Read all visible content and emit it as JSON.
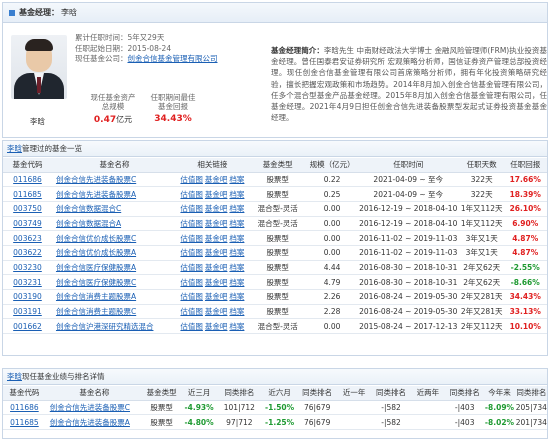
{
  "header": {
    "label": "基金经理：",
    "name": "李晗"
  },
  "profile": {
    "name": "李晗",
    "tenure_label": "累计任职时间：",
    "tenure_value": "5年又29天",
    "start_label": "任职起始日期：",
    "start_value": "2015-08-24",
    "company_label": "现任基金公司：",
    "company_value": "创金合信基金管理有限公司",
    "stat1_label_1": "现任基金资产",
    "stat1_label_2": "总规模",
    "stat1_value": "0.47",
    "stat1_unit": "亿元",
    "stat2_label_1": "任职期间最佳",
    "stat2_label_2": "基金回报",
    "stat2_value": "34.43%"
  },
  "bio": {
    "title": "基金经理简介：",
    "text": "李晗先生 中南财经政法大学博士 金融风险管理师(FRM)执业投资基金经理。曾任国泰君安证券研究所 宏观策略分析师，国信证券资产管理总部投资经理。现任创金合信基金管理有限公司首席策略分析师，拥有年化投资策略研究经验，擅长把握宏观政策和市场趋势。2014年8月加入创金合信基金管理有限公司，任多个混合型基金产品基金经理。2015年8月加入创金合信基金管理有限公司，任基金经理。2021年4月9日担任创金合信先进装备股票型发起式证券投资基金基金经理。"
  },
  "managed": {
    "section_link": "李晗",
    "section_title": "管理过的基金一览",
    "columns": [
      "基金代码",
      "基金名称",
      "相关链接",
      "基金类型",
      "规模（亿元）",
      "任职时间",
      "任职天数",
      "任职回报"
    ],
    "rel_links": [
      "估值图",
      "基金吧",
      "档案"
    ],
    "rows": [
      {
        "code": "011686",
        "name": "创金合信先进装备股票C",
        "type": "股票型",
        "size": "0.22",
        "period": "2021-04-09 ~ 至今",
        "days": "322天",
        "ret": "17.66%",
        "color": "red"
      },
      {
        "code": "011685",
        "name": "创金合信先进装备股票A",
        "type": "股票型",
        "size": "0.25",
        "period": "2021-04-09 ~ 至今",
        "days": "322天",
        "ret": "18.39%",
        "color": "red"
      },
      {
        "code": "003750",
        "name": "创金合信数据混合C",
        "type": "混合型-灵活",
        "size": "0.00",
        "period": "2016-12-19 ~ 2018-04-10",
        "days": "1年又112天",
        "ret": "26.10%",
        "color": "red"
      },
      {
        "code": "003749",
        "name": "创金合信数据混合A",
        "type": "混合型-灵活",
        "size": "0.00",
        "period": "2016-12-19 ~ 2018-04-10",
        "days": "1年又112天",
        "ret": "6.90%",
        "color": "red"
      },
      {
        "code": "003623",
        "name": "创金合信优价成长股票C",
        "type": "股票型",
        "size": "0.00",
        "period": "2016-11-02 ~ 2019-11-03",
        "days": "3年又1天",
        "ret": "4.87%",
        "color": "red"
      },
      {
        "code": "003622",
        "name": "创金合信优价成长股票A",
        "type": "股票型",
        "size": "0.00",
        "period": "2016-11-02 ~ 2019-11-03",
        "days": "3年又1天",
        "ret": "4.87%",
        "color": "red"
      },
      {
        "code": "003230",
        "name": "创金合信医疗保健股票A",
        "type": "股票型",
        "size": "4.44",
        "period": "2016-08-30 ~ 2018-10-31",
        "days": "2年又62天",
        "ret": "-2.55%",
        "color": "green"
      },
      {
        "code": "003231",
        "name": "创金合信医疗保健股票C",
        "type": "股票型",
        "size": "4.79",
        "period": "2016-08-30 ~ 2018-10-31",
        "days": "2年又62天",
        "ret": "-8.66%",
        "color": "green"
      },
      {
        "code": "003190",
        "name": "创金合信消费主题股票A",
        "type": "股票型",
        "size": "2.26",
        "period": "2016-08-24 ~ 2019-05-30",
        "days": "2年又281天",
        "ret": "34.43%",
        "color": "red"
      },
      {
        "code": "003191",
        "name": "创金合信消费主题股票C",
        "type": "股票型",
        "size": "2.28",
        "period": "2016-08-24 ~ 2019-05-30",
        "days": "2年又281天",
        "ret": "33.13%",
        "color": "red"
      },
      {
        "code": "001662",
        "name": "创金合信沪港深研究精选混合",
        "type": "混合型-灵活",
        "size": "0.00",
        "period": "2015-08-24 ~ 2017-12-13",
        "days": "2年又112天",
        "ret": "10.10%",
        "color": "red"
      }
    ]
  },
  "current": {
    "section_link": "李晗",
    "section_title": "现任基金业绩与排名详情",
    "columns": [
      "基金代码",
      "基金名称",
      "基金类型",
      "近三月",
      "同类排名",
      "近六月",
      "同类排名",
      "近一年",
      "同类排名",
      "近两年",
      "同类排名",
      "今年来",
      "同类排名"
    ],
    "rows": [
      {
        "code": "011686",
        "name": "创金合信先进装备股票C",
        "type": "股票型",
        "m3": "-4.93%",
        "r3": "101|712",
        "m6": "-1.50%",
        "r6": "76|679",
        "y1": "",
        "ry1": "-|582",
        "y2": "",
        "ry2": "-|403",
        "ytd": "-8.09%",
        "rytd": "205|734"
      },
      {
        "code": "011685",
        "name": "创金合信先进装备股票A",
        "type": "股票型",
        "m3": "-4.80%",
        "r3": "97|712",
        "m6": "-1.25%",
        "r6": "76|679",
        "y1": "",
        "ry1": "-|582",
        "y2": "",
        "ry2": "-|403",
        "ytd": "-8.02%",
        "rytd": "201|734"
      }
    ]
  },
  "colors": {
    "accent": "#1a5fb4",
    "up": "#e02020",
    "down": "#1f9a32",
    "header_bg": "#eef3f9"
  }
}
